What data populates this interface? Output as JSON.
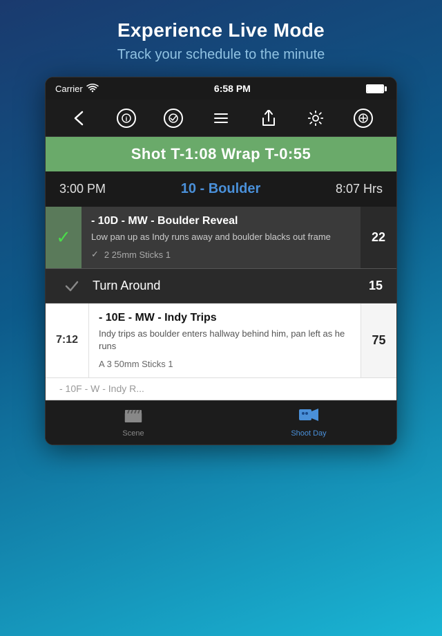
{
  "promo": {
    "title": "Experience Live Mode",
    "subtitle": "Track your schedule to the minute"
  },
  "status_bar": {
    "carrier": "Carrier",
    "wifi": "📶",
    "time": "6:58 PM"
  },
  "toolbar": {
    "buttons": [
      "back",
      "info",
      "check",
      "list",
      "share",
      "gear",
      "plus"
    ]
  },
  "shot_wrap": {
    "text": "Shot T-1:08  Wrap T-0:55"
  },
  "scene_header": {
    "time": "3:00 PM",
    "name": "10 - Boulder",
    "hours": "8:07 Hrs"
  },
  "shot_10d": {
    "title": "- 10D - MW - Boulder Reveal",
    "description": "Low pan up as Indy runs away and boulder blacks out frame",
    "meta": "2  25mm  Sticks  1",
    "pages": "22",
    "completed": true
  },
  "turnaround": {
    "label": "Turn Around",
    "pages": "15"
  },
  "shot_10e": {
    "time": "7:12",
    "title": "- 10E - MW - Indy Trips",
    "description": "Indy trips as boulder enters hallway behind him, pan left as he runs",
    "meta": "A  3  50mm  Sticks  1",
    "pages": "75"
  },
  "partial_row": {
    "text": "- 10F - W - Indy R..."
  },
  "tabs": [
    {
      "id": "scene",
      "label": "Scene",
      "active": false
    },
    {
      "id": "shoot-day",
      "label": "Shoot Day",
      "active": true
    }
  ]
}
